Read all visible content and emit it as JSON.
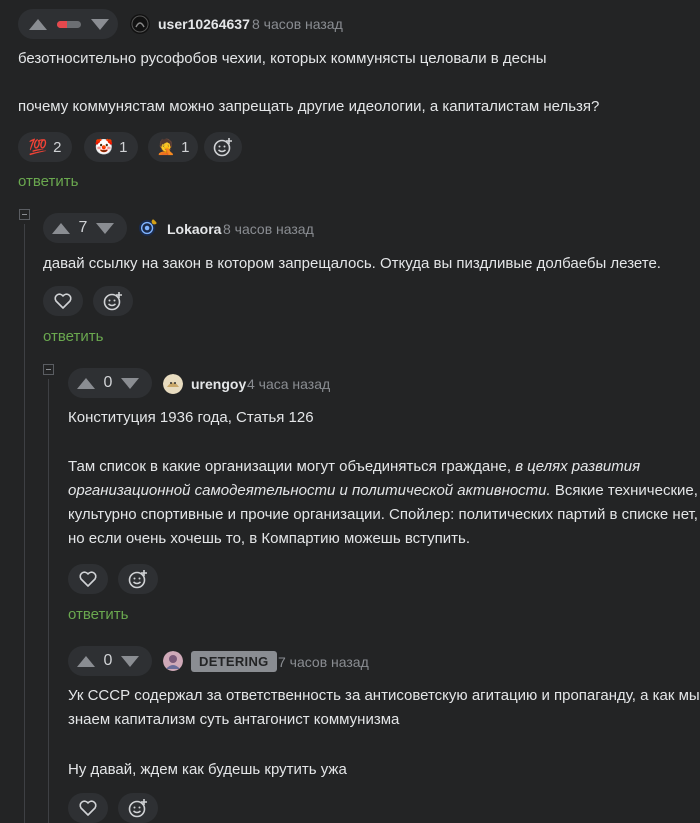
{
  "comments": [
    {
      "username": "user10264637",
      "time": "8 часов назад",
      "rating_fraction_negative": 0.4,
      "paragraphs": [
        "безотносительно русофобов чехии, которых коммунясты целовали в десны",
        "почему коммунястам можно запрещать другие идеологии, а капиталистам нельзя?"
      ],
      "reactions": [
        {
          "emoji": "💯",
          "icon": "hundred-points-icon",
          "count": "2"
        },
        {
          "emoji": "🤡",
          "icon": "clown-icon",
          "count": "1"
        },
        {
          "emoji": "🤦",
          "icon": "facepalm-icon",
          "count": "1"
        }
      ],
      "reply_label": "ответить"
    },
    {
      "username": "Lokaora",
      "time": "8 часов назад",
      "score": "7",
      "paragraphs": [
        "давай ссылку на закон в котором запрещалось. Откуда вы пиздливые долбаебы лезете."
      ],
      "reply_label": "ответить"
    },
    {
      "username": "urengoy",
      "time": "4 часа назад",
      "score": "0",
      "paragraph1": "Конституция 1936 года, Статья 126",
      "p2_line1_normal": "Там список в какие организации могут объединяться граждане, ",
      "p2_line1_italic": "в целях развития",
      "p2_line2_italic": "организационной самодеятельности и политической активности.",
      "p2_line2_normal": " Всякие технические,",
      "p2_line3": "культурно спортивные и прочие организации. Спойлер: политических партий в списке нет,",
      "p2_line4": "но если очень хочешь то, в Компартию можешь вступить.",
      "reply_label": "ответить"
    },
    {
      "username": "DETERING",
      "time": "7 часов назад",
      "score": "0",
      "line1": "Ук СССР содержал за ответственность за антисоветскую агитацию и пропаганду, а как мы",
      "line2": "знаем капитализм суть антагонист коммунизма",
      "line3": "Ну давай, ждем как будешь крутить ужа"
    }
  ],
  "colors": {
    "background": "#232425",
    "pill": "#2e3033",
    "reply_link": "#6aa84f",
    "negative_rating": "#e5484d",
    "muted": "#8a8d92"
  }
}
